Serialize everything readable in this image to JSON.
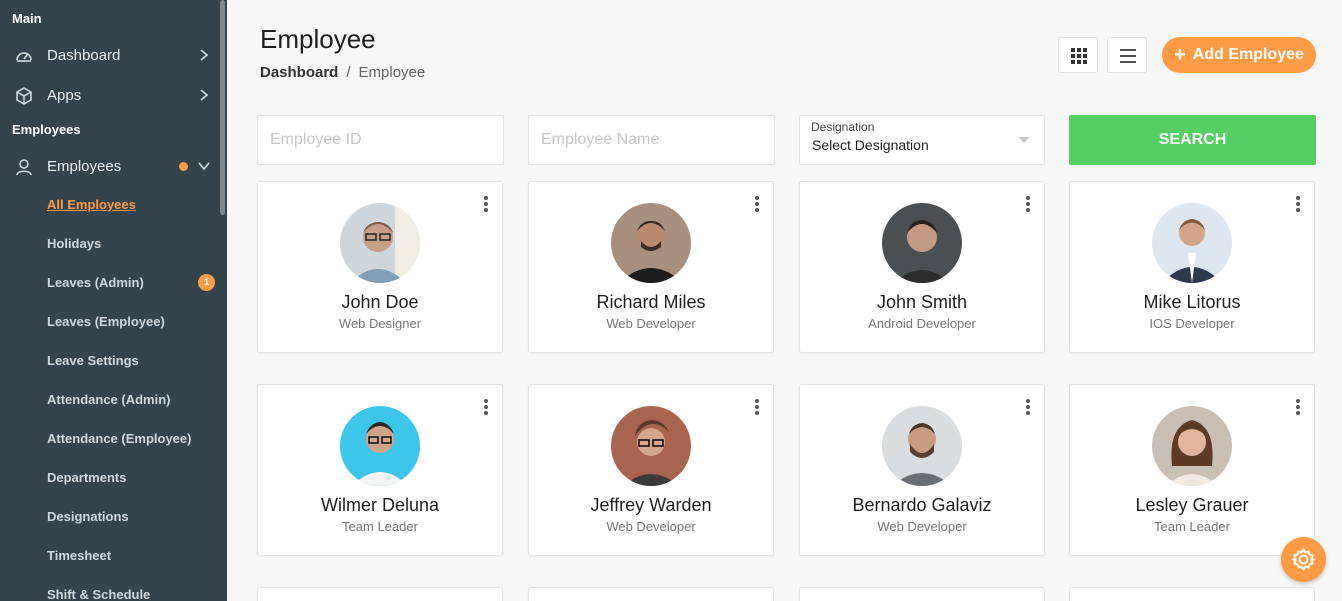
{
  "sidebar": {
    "sections": [
      "Main",
      "Employees"
    ],
    "items": [
      {
        "label": "Dashboard",
        "icon": "dashboard-icon"
      },
      {
        "label": "Apps",
        "icon": "cube-icon"
      },
      {
        "label": "Employees",
        "icon": "user-icon"
      }
    ],
    "subitems": [
      {
        "label": "All Employees"
      },
      {
        "label": "Holidays"
      },
      {
        "label": "Leaves (Admin)",
        "badge": "1"
      },
      {
        "label": "Leaves (Employee)"
      },
      {
        "label": "Leave Settings"
      },
      {
        "label": "Attendance (Admin)"
      },
      {
        "label": "Attendance (Employee)"
      },
      {
        "label": "Departments"
      },
      {
        "label": "Designations"
      },
      {
        "label": "Timesheet"
      },
      {
        "label": "Shift & Schedule"
      }
    ]
  },
  "header": {
    "title": "Employee",
    "breadcrumb": {
      "home": "Dashboard",
      "sep": "/",
      "current": "Employee"
    },
    "add_button": "Add Employee",
    "add_icon": "+"
  },
  "filters": {
    "employee_id_placeholder": "Employee ID",
    "employee_name_placeholder": "Employee Name",
    "designation_label": "Designation",
    "designation_value": "Select Designation",
    "search_label": "SEARCH"
  },
  "employees": [
    {
      "name": "John Doe",
      "role": "Web Designer"
    },
    {
      "name": "Richard Miles",
      "role": "Web Developer"
    },
    {
      "name": "John Smith",
      "role": "Android Developer"
    },
    {
      "name": "Mike Litorus",
      "role": "IOS Developer"
    },
    {
      "name": "Wilmer Deluna",
      "role": "Team Leader"
    },
    {
      "name": "Jeffrey Warden",
      "role": "Web Developer"
    },
    {
      "name": "Bernardo Galaviz",
      "role": "Web Developer"
    },
    {
      "name": "Lesley Grauer",
      "role": "Team Leader"
    }
  ],
  "colors": {
    "accent": "#ff9b44",
    "search": "#55ce63",
    "sidebar": "#34444c"
  }
}
